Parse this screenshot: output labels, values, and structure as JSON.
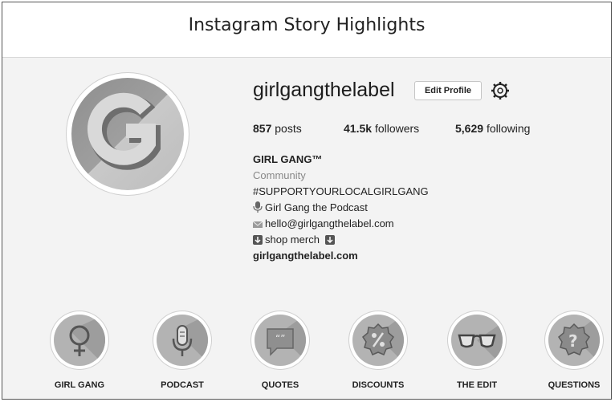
{
  "header": {
    "title": "Instagram Story Highlights"
  },
  "profile": {
    "username": "girlgangthelabel",
    "edit_button": "Edit Profile",
    "stats": {
      "posts_count": "857",
      "posts_label": "posts",
      "followers_count": "41.5k",
      "followers_label": "followers",
      "following_count": "5,629",
      "following_label": "following"
    },
    "bio": {
      "name": "GIRL GANG™",
      "category": "Community",
      "hashtag": "#SUPPORTYOURLOCALGIRLGANG",
      "podcast": "Girl Gang the Podcast",
      "email": "hello@girlgangthelabel.com",
      "shop": "shop merch",
      "website": "girlgangthelabel.com"
    }
  },
  "highlights": [
    {
      "label": "GIRL GANG",
      "icon": "female-symbol-icon"
    },
    {
      "label": "PODCAST",
      "icon": "microphone-icon"
    },
    {
      "label": "QUOTES",
      "icon": "quote-bubble-icon"
    },
    {
      "label": "DISCOUNTS",
      "icon": "percent-badge-icon"
    },
    {
      "label": "THE EDIT",
      "icon": "glasses-icon"
    },
    {
      "label": "QUESTIONS",
      "icon": "question-badge-icon"
    }
  ]
}
